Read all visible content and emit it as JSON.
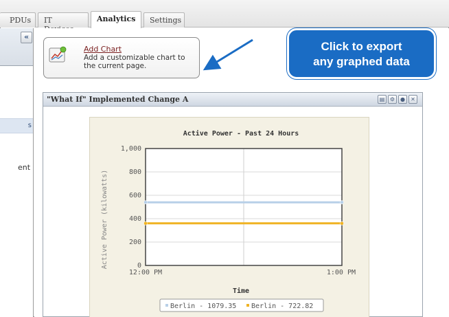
{
  "tabs": [
    {
      "label": "PDUs",
      "active": false
    },
    {
      "label": "IT Devices",
      "active": false
    },
    {
      "label": "Analytics",
      "active": true
    },
    {
      "label": "Settings",
      "active": false
    }
  ],
  "sidebar": {
    "collapse_glyph": "«",
    "selected_item_fragment": "s",
    "item_fragment": "ent"
  },
  "add_chart": {
    "link_label": "Add Chart",
    "description": "Add a customizable chart to the current page."
  },
  "callout": {
    "line1": "Click to export",
    "line2": "any graphed data"
  },
  "panel": {
    "title": "\"What If\" Implemented Change A",
    "buttons": [
      "export-icon",
      "settings-icon",
      "refresh-icon",
      "close-icon"
    ]
  },
  "chart_data": {
    "type": "line",
    "title": "Active Power - Past 24 Hours",
    "xlabel": "Time",
    "ylabel": "Active Power (kilowatts)",
    "x_ticks": [
      "12:00 PM",
      "1:00 PM"
    ],
    "y_ticks": [
      0,
      200,
      400,
      600,
      800,
      1000
    ],
    "y_tick_labels": [
      "0",
      "200",
      "400",
      "600",
      "800",
      "1,000"
    ],
    "ylim": [
      0,
      1000
    ],
    "grid": true,
    "legend_position": "bottom",
    "series": [
      {
        "name": "Berlin - 1079.35",
        "color": "#b8d0e8",
        "x": [
          "12:00 PM",
          "1:00 PM"
        ],
        "values": [
          540,
          540
        ]
      },
      {
        "name": "Berlin - 722.82",
        "color": "#f0b323",
        "x": [
          "12:00 PM",
          "1:00 PM"
        ],
        "values": [
          360,
          360
        ]
      }
    ]
  },
  "colors": {
    "callout_bg": "#1a6cc4",
    "link": "#7a1f1f",
    "chart_bg": "#f4f1e4"
  }
}
